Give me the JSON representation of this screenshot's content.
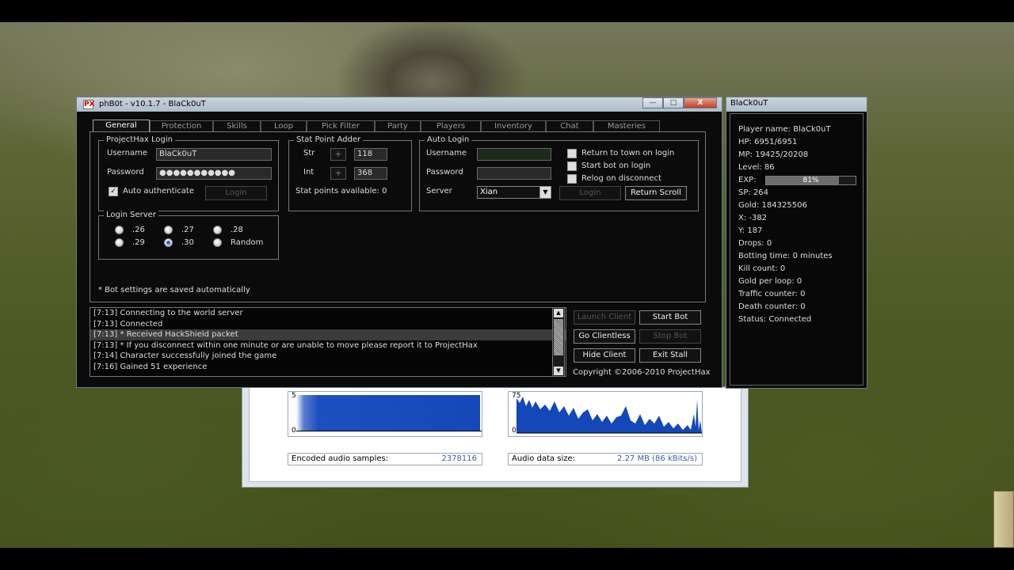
{
  "encoder": {
    "graph_left_ytop": "5",
    "graph_left_yzero": "0",
    "graph_right_ytop": "75",
    "graph_right_yzero": "0",
    "encoded_label": "Encoded audio samples:",
    "encoded_value": "2378116",
    "audio_label": "Audio data size:",
    "audio_value": "2.27 MB (86 kBits/s)"
  },
  "main": {
    "title": "phB0t - v10.1.7 - BlaCk0uT",
    "app_icon": "PX",
    "caption": {
      "minimize": "—",
      "maximize": "□",
      "close": "X"
    },
    "tabs": [
      {
        "label": "General"
      },
      {
        "label": "Protection"
      },
      {
        "label": "Skills"
      },
      {
        "label": "Loop"
      },
      {
        "label": "Pick Filter"
      },
      {
        "label": "Party"
      },
      {
        "label": "Players"
      },
      {
        "label": "Inventory"
      },
      {
        "label": "Chat"
      },
      {
        "label": "Masteries"
      }
    ],
    "login": {
      "title": "ProjectHax Login",
      "username_label": "Username",
      "username_value": "BlaCk0uT",
      "password_label": "Password",
      "password_value": "●●●●●●●●●●●",
      "auto_auth_label": "Auto authenticate",
      "auto_auth_checked": true,
      "login_button": "Login"
    },
    "stat": {
      "title": "Stat Point Adder",
      "str_label": "Str",
      "str_value": "118",
      "int_label": "Int",
      "int_value": "368",
      "plus": "+",
      "available": "Stat points available: 0"
    },
    "auto_login": {
      "title": "Auto Login",
      "username_label": "Username",
      "password_label": "Password",
      "server_label": "Server",
      "server_value": "Xian",
      "login_button": "Login",
      "return_scroll_button": "Return Scroll",
      "return_town_label": "Return to town on login",
      "start_bot_label": "Start bot on login",
      "relog_label": "Relog on disconnect"
    },
    "login_server": {
      "title": "Login Server",
      "options": [
        ".26",
        ".27",
        ".28",
        ".29",
        ".30",
        "Random"
      ],
      "selected": ".30"
    },
    "note": "* Bot settings are saved automatically",
    "log": [
      "[7:13] Connecting to the world server",
      "[7:13] Connected",
      "[7:13] * Received HackShield packet",
      "[7:13] * If you disconnect within one minute or are unable to move please report it to ProjectHax",
      "[7:14] Character successfully joined the game",
      "[7:16] Gained 51 experience"
    ],
    "buttons": {
      "launch_client": "Launch Client",
      "start_bot": "Start Bot",
      "go_clientless": "Go Clientless",
      "stop_bot": "Stop Bot",
      "hide_client": "Hide Client",
      "exit_stall": "Exit Stall"
    },
    "copyright": "Copyright ©2006-2010 ProjectHax"
  },
  "side": {
    "title": "BlaCk0uT",
    "player_name": "Player name: BlaCk0uT",
    "hp": "HP: 6951/6951",
    "mp": "MP: 19425/20208",
    "level": "Level: 86",
    "exp_label": "EXP:",
    "exp_percent": "81%",
    "exp_fraction": 0.81,
    "sp": "SP: 264",
    "gold": "Gold: 184325506",
    "x": "X: -382",
    "y": "Y: 187",
    "drops": "Drops: 0",
    "botting_time": "Botting time: 0 minutes",
    "kill_count": "Kill count: 0",
    "gold_per_loop": "Gold per loop: 0",
    "traffic": "Traffic counter: 0",
    "death": "Death counter: 0",
    "status": "Status: Connected"
  }
}
